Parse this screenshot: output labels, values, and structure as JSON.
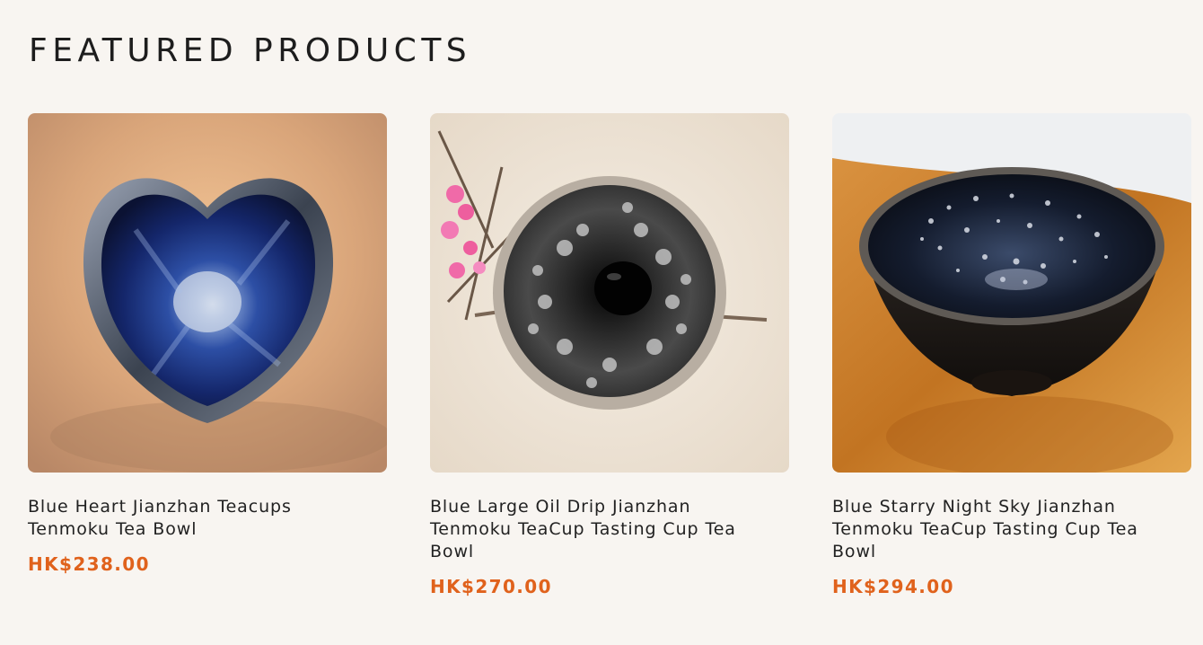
{
  "section": {
    "title": "FEATURED PRODUCTS"
  },
  "products": [
    {
      "name": "Blue Heart Jianzhan Teacups Tenmoku Tea Bowl",
      "price": "HK$238.00",
      "image_icon": "heart-shaped-blue-tea-bowl"
    },
    {
      "name": "Blue Large Oil Drip Jianzhan Tenmoku TeaCup Tasting Cup Tea Bowl",
      "price": "HK$270.00",
      "image_icon": "oil-drip-tea-bowl"
    },
    {
      "name": "Blue Starry Night Sky Jianzhan Tenmoku TeaCup Tasting Cup Tea Bowl",
      "price": "HK$294.00",
      "image_icon": "starry-night-tea-bowl"
    }
  ],
  "colors": {
    "background": "#f8f5f1",
    "price": "#e0621c",
    "title": "#1d1d1d"
  }
}
